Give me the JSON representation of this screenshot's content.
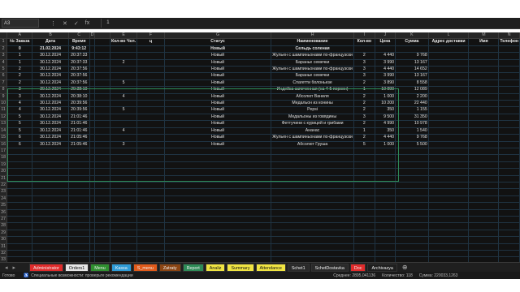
{
  "formula": {
    "cell_ref": "A3",
    "value": "1",
    "icons": [
      "⋮",
      "✕",
      "✓",
      "fx"
    ]
  },
  "columns": [
    "A",
    "B",
    "C",
    "D",
    "E",
    "F",
    "G",
    "H",
    "I",
    "J",
    "K",
    "L",
    "M",
    "N"
  ],
  "header_row": {
    "num": "1",
    "cells": [
      "№ Заказа",
      "Дата",
      "Время",
      "",
      "Кол-во Чел.",
      "ц",
      "Статус",
      "Наименование",
      "Кол-во",
      "Цена",
      "Сумма",
      "Адрес доставки",
      "Имя",
      "Телефон"
    ]
  },
  "rows": [
    {
      "num": "2",
      "cells": [
        "0",
        "21.02.2024",
        "9:43:12",
        "",
        "",
        "",
        "Новый",
        "Сельдь соленая",
        "",
        "",
        "",
        "",
        "",
        ""
      ],
      "bold": true
    },
    {
      "num": "3",
      "cells": [
        "1",
        "30.12.2024",
        "20:37:33",
        "",
        "",
        "",
        "Новый",
        "Жульен с шампиньонами по-французски",
        "2",
        "4 440",
        "9 768",
        "",
        "",
        ""
      ]
    },
    {
      "num": "4",
      "cells": [
        "1",
        "30.12.2024",
        "20:37:33",
        "",
        "2",
        "",
        "Новый",
        "Баранье семечки",
        "3",
        "3 990",
        "13 167",
        "",
        "",
        ""
      ]
    },
    {
      "num": "5",
      "cells": [
        "2",
        "30.12.2024",
        "20:37:56",
        "",
        "",
        "",
        "Новый",
        "Жульен с шампиньонами по-французски",
        "3",
        "4 440",
        "14 652",
        "",
        "",
        ""
      ]
    },
    {
      "num": "6",
      "cells": [
        "2",
        "30.12.2024",
        "20:37:56",
        "",
        "",
        "",
        "Новый",
        "Баранье семечки",
        "3",
        "3 990",
        "13 167",
        "",
        "",
        ""
      ]
    },
    {
      "num": "7",
      "cells": [
        "2",
        "30.12.2024",
        "20:37:56",
        "",
        "5",
        "",
        "Новый",
        "Спагетти болоньезе",
        "2",
        "3 890",
        "8 558",
        "",
        "",
        ""
      ]
    },
    {
      "num": "8",
      "cells": [
        "3",
        "30.12.2024",
        "20:38:10",
        "",
        "",
        "",
        "Новый",
        "Индейка запеченная (на 4-5 персон)",
        "1",
        "10 990",
        "12 089",
        "",
        "",
        ""
      ]
    },
    {
      "num": "9",
      "cells": [
        "3",
        "30.12.2024",
        "20:38:10",
        "",
        "4",
        "",
        "Новый",
        "Абсолют Ваниля",
        "2",
        "1 000",
        "2 200",
        "",
        "",
        ""
      ]
    },
    {
      "num": "10",
      "cells": [
        "4",
        "30.12.2024",
        "20:39:56",
        "",
        "",
        "",
        "Новый",
        "Медальон из конины",
        "2",
        "10 200",
        "22 440",
        "",
        "",
        ""
      ]
    },
    {
      "num": "11",
      "cells": [
        "4",
        "30.12.2024",
        "20:39:56",
        "",
        "5",
        "",
        "Новый",
        "Pepsi",
        "2",
        "350",
        "1 155",
        "",
        "",
        ""
      ]
    },
    {
      "num": "12",
      "cells": [
        "5",
        "30.12.2024",
        "21:01:46",
        "",
        "",
        "",
        "Новый",
        "Медальоны из говядины",
        "3",
        "9 500",
        "31 350",
        "",
        "",
        ""
      ]
    },
    {
      "num": "13",
      "cells": [
        "5",
        "30.12.2024",
        "21:01:46",
        "",
        "",
        "",
        "Новый",
        "Феттучини с курицей и грибами",
        "2",
        "4 990",
        "10 978",
        "",
        "",
        ""
      ]
    },
    {
      "num": "14",
      "cells": [
        "5",
        "30.12.2024",
        "21:01:46",
        "",
        "4",
        "",
        "Новый",
        "Ананас",
        "1",
        "350",
        "1 540",
        "",
        "",
        ""
      ]
    },
    {
      "num": "15",
      "cells": [
        "6",
        "30.12.2024",
        "21:05:46",
        "",
        "",
        "",
        "Новый",
        "Жульен с шампиньонами по-французски",
        "2",
        "4 440",
        "9 768",
        "",
        "",
        ""
      ]
    },
    {
      "num": "16",
      "cells": [
        "6",
        "30.12.2024",
        "21:05:46",
        "",
        "3",
        "",
        "Новый",
        "Абсолют Груша",
        "5",
        "1 000",
        "5 500",
        "",
        "",
        ""
      ]
    }
  ],
  "empty_rows": [
    "17",
    "18",
    "19",
    "20",
    "21",
    "22",
    "23",
    "24",
    "25",
    "26",
    "27",
    "28",
    "29",
    "30",
    "31",
    "32",
    "33",
    "34",
    "35",
    "36"
  ],
  "tabs": [
    {
      "label": "Administrator",
      "bg": "#e02b2b"
    },
    {
      "label": "Orders1",
      "bg": "#e6e6e6"
    },
    {
      "label": "Menu",
      "bg": "#2f8f2f"
    },
    {
      "label": "Kassa",
      "bg": "#2e9bd6"
    },
    {
      "label": "S_menu",
      "bg": "#e05a1a"
    },
    {
      "label": "Zatraty",
      "bg": "#8b4513"
    },
    {
      "label": "Report",
      "bg": "#2e8b57"
    },
    {
      "label": "Analiz",
      "bg": "#f0e442"
    },
    {
      "label": "Summary",
      "bg": "#f0e442"
    },
    {
      "label": "Attendance",
      "bg": "#f0e442"
    },
    {
      "label": "Schet1",
      "bg": "#2a2a2a"
    },
    {
      "label": "SchetDostavka",
      "bg": "#2a2a2a"
    },
    {
      "label": "Doc",
      "bg": "#e02b2b"
    },
    {
      "label": "Archivazya",
      "bg": "#1f1f1f"
    }
  ],
  "status": {
    "mode": "Готово",
    "accessibility": "Специальные возможности: проверьте рекомендации",
    "average": "Среднее: 2895,041136",
    "count": "Количество: 118",
    "sum": "Сумма: 220033,1263"
  }
}
